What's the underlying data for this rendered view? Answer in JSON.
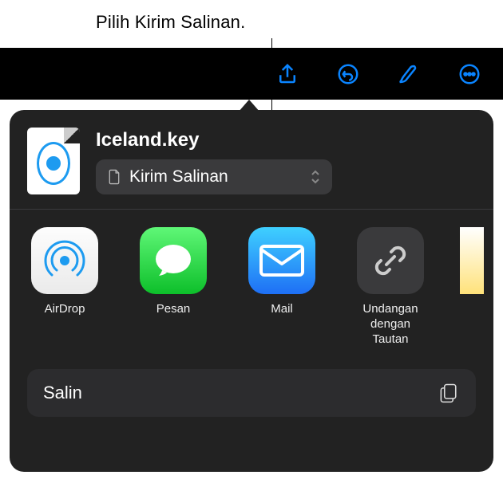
{
  "annotation": "Pilih Kirim Salinan.",
  "toolbar_icons": {
    "share": "share-icon",
    "undo": "undo-icon",
    "brush": "brush-icon",
    "more": "more-icon"
  },
  "file": {
    "name": "Iceland.key",
    "dropdown_label": "Kirim Salinan"
  },
  "apps": [
    {
      "id": "airdrop",
      "label": "AirDrop"
    },
    {
      "id": "messages",
      "label": "Pesan"
    },
    {
      "id": "mail",
      "label": "Mail"
    },
    {
      "id": "invite-link",
      "label": "Undangan\ndengan Tautan"
    }
  ],
  "actions": {
    "copy": "Salin"
  }
}
